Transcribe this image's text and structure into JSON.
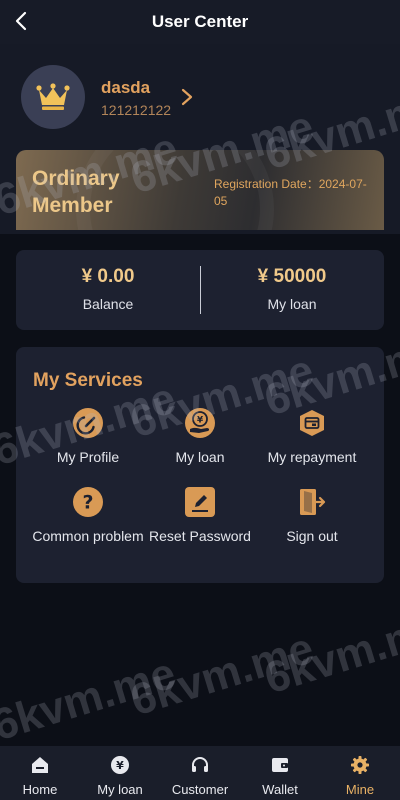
{
  "header": {
    "title": "User Center"
  },
  "profile": {
    "username": "dasda",
    "user_id": "121212122",
    "member_level": "Ordinary Member",
    "registration_date": "Registration Date：2024-07-05"
  },
  "balance": {
    "balance_value": "¥ 0.00",
    "balance_label": "Balance",
    "loan_value": "¥ 50000",
    "loan_label": "My loan"
  },
  "services": {
    "title": "My Services",
    "items": [
      {
        "label": "My Profile",
        "icon": "pencil-circle-icon"
      },
      {
        "label": "My loan",
        "icon": "yen-coin-icon"
      },
      {
        "label": "My repayment",
        "icon": "wallet-card-icon"
      },
      {
        "label": "Common problem",
        "icon": "question-circle-icon"
      },
      {
        "label": "Reset Password",
        "icon": "edit-square-icon"
      },
      {
        "label": "Sign out",
        "icon": "exit-door-icon"
      }
    ]
  },
  "nav": {
    "items": [
      {
        "label": "Home",
        "icon": "home-icon"
      },
      {
        "label": "My loan",
        "icon": "yen-circle-icon"
      },
      {
        "label": "Customer",
        "icon": "headset-icon"
      },
      {
        "label": "Wallet",
        "icon": "wallet-icon"
      },
      {
        "label": "Mine",
        "icon": "gear-icon",
        "active": true
      }
    ]
  },
  "watermark": "6kvm.me",
  "colors": {
    "accent_gold": "#e2a25f",
    "background": "#0c0f17",
    "card": "#1d2130",
    "active_nav": "#e8b165"
  }
}
